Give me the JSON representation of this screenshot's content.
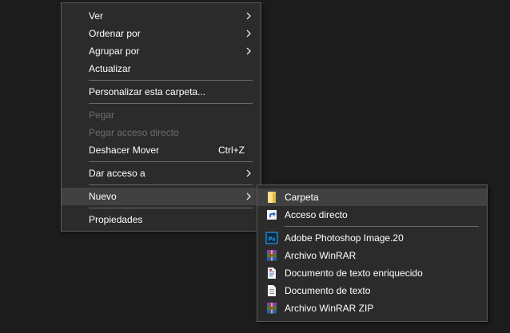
{
  "main_menu": {
    "items": [
      {
        "label": "Ver"
      },
      {
        "label": "Ordenar por"
      },
      {
        "label": "Agrupar por"
      },
      {
        "label": "Actualizar"
      },
      {
        "label": "Personalizar esta carpeta..."
      },
      {
        "label": "Pegar"
      },
      {
        "label": "Pegar acceso directo"
      },
      {
        "label": "Deshacer Mover",
        "shortcut": "Ctrl+Z"
      },
      {
        "label": "Dar acceso a"
      },
      {
        "label": "Nuevo"
      },
      {
        "label": "Propiedades"
      }
    ]
  },
  "sub_menu": {
    "items": [
      {
        "label": "Carpeta",
        "icon": "folder-icon"
      },
      {
        "label": "Acceso directo",
        "icon": "shortcut-icon"
      },
      {
        "label": "Adobe Photoshop Image.20",
        "icon": "photoshop-icon"
      },
      {
        "label": "Archivo WinRAR",
        "icon": "winrar-icon"
      },
      {
        "label": "Documento de texto enriquecido",
        "icon": "rich-text-document-icon"
      },
      {
        "label": "Documento de texto",
        "icon": "text-document-icon"
      },
      {
        "label": "Archivo WinRAR ZIP",
        "icon": "winrar-zip-icon"
      }
    ]
  },
  "colors": {
    "menu_bg": "#2b2b2b",
    "highlight": "#414141",
    "text": "#ffffff",
    "disabled_text": "#6d6d6d",
    "separator": "#6a6a6a"
  }
}
